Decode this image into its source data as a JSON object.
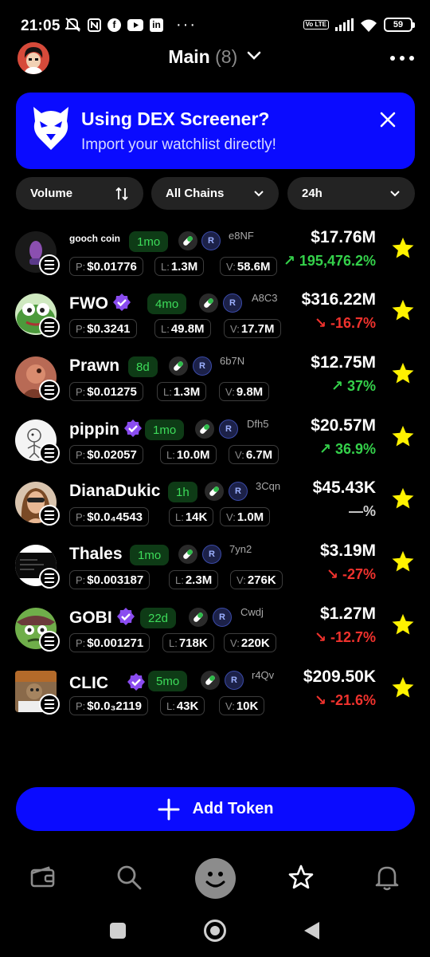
{
  "status_bar": {
    "time": "21:05",
    "left_icons": [
      "mute-icon",
      "nfc-icon",
      "facebook-icon",
      "youtube-icon",
      "linkedin-icon"
    ],
    "more_notifications": "···",
    "volte_label": "Vo LTE",
    "battery": "59"
  },
  "header": {
    "title": "Main",
    "count": "(8)"
  },
  "banner": {
    "title": "Using DEX Screener?",
    "subtitle": "Import your watchlist directly!"
  },
  "filters": {
    "sort": "Volume",
    "chains": "All Chains",
    "timeframe": "24h"
  },
  "tokens": [
    {
      "name": "gooch coin",
      "age": "1mo",
      "addr": "e8NF",
      "price_label": "P:",
      "price": "$0.01776",
      "liq_label": "L:",
      "liq": "1.3M",
      "vol_label": "V:",
      "vol": "58.6M",
      "mcap": "$17.76M",
      "change": "↗ 195,476.2%",
      "verified": false
    },
    {
      "name": "FWO",
      "age": "4mo",
      "addr": "A8C3",
      "price_label": "P:",
      "price": "$0.3241",
      "liq_label": "L:",
      "liq": "49.8M",
      "vol_label": "V:",
      "vol": "17.7M",
      "mcap": "$316.22M",
      "change": "↘ -16.7%",
      "verified": true
    },
    {
      "name": "Prawn",
      "age": "8d",
      "addr": "6b7N",
      "price_label": "P:",
      "price": "$0.01275",
      "liq_label": "L:",
      "liq": "1.3M",
      "vol_label": "V:",
      "vol": "9.8M",
      "mcap": "$12.75M",
      "change": "↗ 37%",
      "verified": false
    },
    {
      "name": "pippin",
      "age": "1mo",
      "addr": "Dfh5",
      "price_label": "P:",
      "price": "$0.02057",
      "liq_label": "L:",
      "liq": "10.0M",
      "vol_label": "V:",
      "vol": "6.7M",
      "mcap": "$20.57M",
      "change": "↗ 36.9%",
      "verified": true
    },
    {
      "name": "DianaDukic",
      "age": "1h",
      "addr": "3Cqn",
      "price_label": "P:",
      "price": "$0.0₄4543",
      "liq_label": "L:",
      "liq": "14K",
      "vol_label": "V:",
      "vol": "1.0M",
      "mcap": "$45.43K",
      "change": "—%",
      "verified": false
    },
    {
      "name": "Thales",
      "age": "1mo",
      "addr": "7yn2",
      "price_label": "P:",
      "price": "$0.003187",
      "liq_label": "L:",
      "liq": "2.3M",
      "vol_label": "V:",
      "vol": "276K",
      "mcap": "$3.19M",
      "change": "↘ -27%",
      "verified": false
    },
    {
      "name": "GOBI",
      "age": "22d",
      "addr": "Cwdj",
      "price_label": "P:",
      "price": "$0.001271",
      "liq_label": "L:",
      "liq": "718K",
      "vol_label": "V:",
      "vol": "220K",
      "mcap": "$1.27M",
      "change": "↘ -12.7%",
      "verified": true
    },
    {
      "name": "CLIC",
      "age": "5mo",
      "addr": "r4Qv",
      "price_label": "P:",
      "price": "$0.0₃2119",
      "liq_label": "L:",
      "liq": "43K",
      "vol_label": "V:",
      "vol": "10K",
      "mcap": "$209.50K",
      "change": "↘ -21.6%",
      "verified": true
    }
  ],
  "add_token_label": "Add Token",
  "bottom_nav": [
    "wallet-icon",
    "search-icon",
    "smiley-icon",
    "star-icon",
    "bell-icon"
  ],
  "colors": {
    "brand_blue": "#0a0bff",
    "up_green": "#34d04a",
    "down_red": "#f0322d",
    "age_green": "#3ddc5a",
    "star_yellow": "#fff200"
  }
}
